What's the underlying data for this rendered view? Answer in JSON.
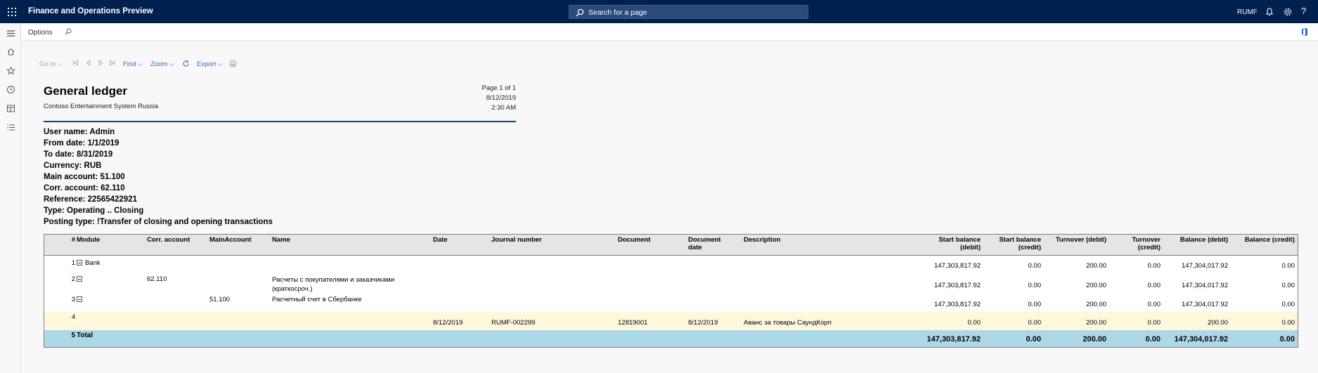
{
  "app": {
    "title": "Finance and Operations Preview",
    "search_placeholder": "Search for a page",
    "company": "RUMF",
    "help_label": "?"
  },
  "action_pane": {
    "options_label": "Options"
  },
  "report_toolbar": {
    "goto": "Go to",
    "find": "Find",
    "zoom": "Zoom",
    "export": "Export"
  },
  "report": {
    "title": "General ledger",
    "company": "Contoso Entertainment System Russia",
    "page": "Page 1 of 1",
    "date": "8/12/2019",
    "time": "2:30 AM",
    "params": [
      "User name: Admin",
      "From date: 1/1/2019",
      "To date: 8/31/2019",
      "Currency: RUB",
      "Main account: 51.100",
      "Corr. account: 62.110",
      "Reference: 22565422921",
      "Type: Operating .. Closing",
      "Posting type: !Transfer of closing and opening transactions"
    ]
  },
  "table": {
    "headers": {
      "num": "#",
      "module": "Module",
      "corr_account": "Corr. account",
      "main_account": "MainAccount",
      "name": "Name",
      "date": "Date",
      "journal": "Journal number",
      "document": "Document",
      "doc_date": "Document date",
      "description": "Description",
      "start_debit": "Start balance (debit)",
      "start_credit": "Start balance (credit)",
      "turn_debit": "Turnover (debit)",
      "turn_credit": "Turnover (credit)",
      "bal_debit": "Balance (debit)",
      "bal_credit": "Balance (credit)"
    },
    "rows": [
      {
        "num": "1",
        "module": "Bank",
        "corr": "",
        "main": "",
        "name": "",
        "date": "",
        "journal": "",
        "document": "",
        "doc_date": "",
        "description": "",
        "start_debit": "147,303,817.92",
        "start_credit": "0.00",
        "turn_debit": "200.00",
        "turn_credit": "0.00",
        "bal_debit": "147,304,017.92",
        "bal_credit": "0.00"
      },
      {
        "num": "2",
        "module": "",
        "corr": "62.110",
        "main": "",
        "name": "Расчеты с покупателями и заказчиками (краткосроч.)",
        "date": "",
        "journal": "",
        "document": "",
        "doc_date": "",
        "description": "",
        "start_debit": "147,303,817.92",
        "start_credit": "0.00",
        "turn_debit": "200.00",
        "turn_credit": "0.00",
        "bal_debit": "147,304,017.92",
        "bal_credit": "0.00"
      },
      {
        "num": "3",
        "module": "",
        "corr": "",
        "main": "51.100",
        "name": "Расчетный счет в Сбербанке",
        "date": "",
        "journal": "",
        "document": "",
        "doc_date": "",
        "description": "",
        "start_debit": "147,303,817.92",
        "start_credit": "0.00",
        "turn_debit": "200.00",
        "turn_credit": "0.00",
        "bal_debit": "147,304,017.92",
        "bal_credit": "0.00"
      },
      {
        "num": "4",
        "module": "",
        "corr": "",
        "main": "",
        "name": "",
        "date": "8/12/2019",
        "journal": "RUMF-002299",
        "document": "12819001",
        "doc_date": "8/12/2019",
        "description": "Аванс за товары СаундКорп",
        "start_debit": "0.00",
        "start_credit": "0.00",
        "turn_debit": "200.00",
        "turn_credit": "0.00",
        "bal_debit": "200.00",
        "bal_credit": "0.00"
      }
    ],
    "total": {
      "num": "5",
      "label": "Total",
      "start_debit": "147,303,817.92",
      "start_credit": "0.00",
      "turn_debit": "200.00",
      "turn_credit": "0.00",
      "bal_debit": "147,304,017.92",
      "bal_credit": "0.00"
    }
  },
  "colors": {
    "navbar": "#002050",
    "accent": "#1e3f77",
    "link": "#2b6cc4",
    "detail_row": "#fff8dc",
    "total_row": "#add8e6"
  }
}
